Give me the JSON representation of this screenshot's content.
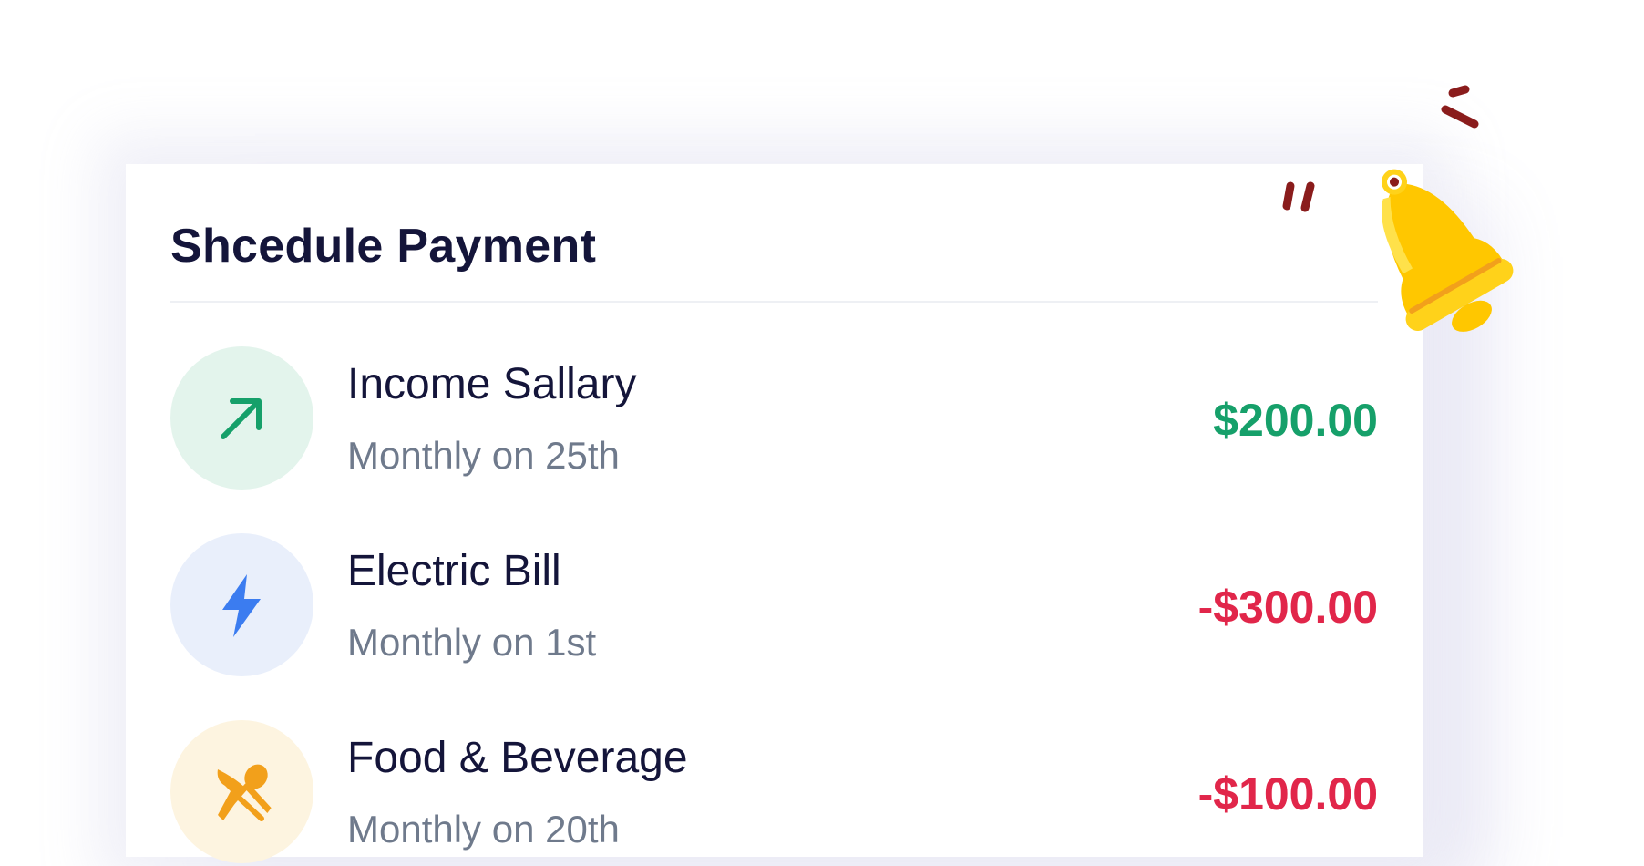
{
  "card": {
    "title": "Shcedule Payment"
  },
  "colors": {
    "title": "#14153a",
    "subtitle": "#6f7a8c",
    "income": "#16a06a",
    "expense": "#e1264a"
  },
  "payments": [
    {
      "name": "Income Sallary",
      "schedule": "Monthly on 25th",
      "amount": "$200.00",
      "icon": "arrow-up-right-icon",
      "icon_color": "#16a06a",
      "icon_bg": "#e3f4ec",
      "amount_color": "#16a06a"
    },
    {
      "name": "Electric Bill",
      "schedule": "Monthly on 1st",
      "amount": "-$300.00",
      "icon": "lightning-icon",
      "icon_color": "#3b7cf0",
      "icon_bg": "#e9effb",
      "amount_color": "#e1264a"
    },
    {
      "name": "Food & Beverage",
      "schedule": "Monthly on 20th",
      "amount": "-$100.00",
      "icon": "fork-spoon-icon",
      "icon_color": "#f2a01b",
      "icon_bg": "#fdf4e0",
      "amount_color": "#e1264a"
    }
  ],
  "decoration": {
    "icon": "bell-icon"
  }
}
